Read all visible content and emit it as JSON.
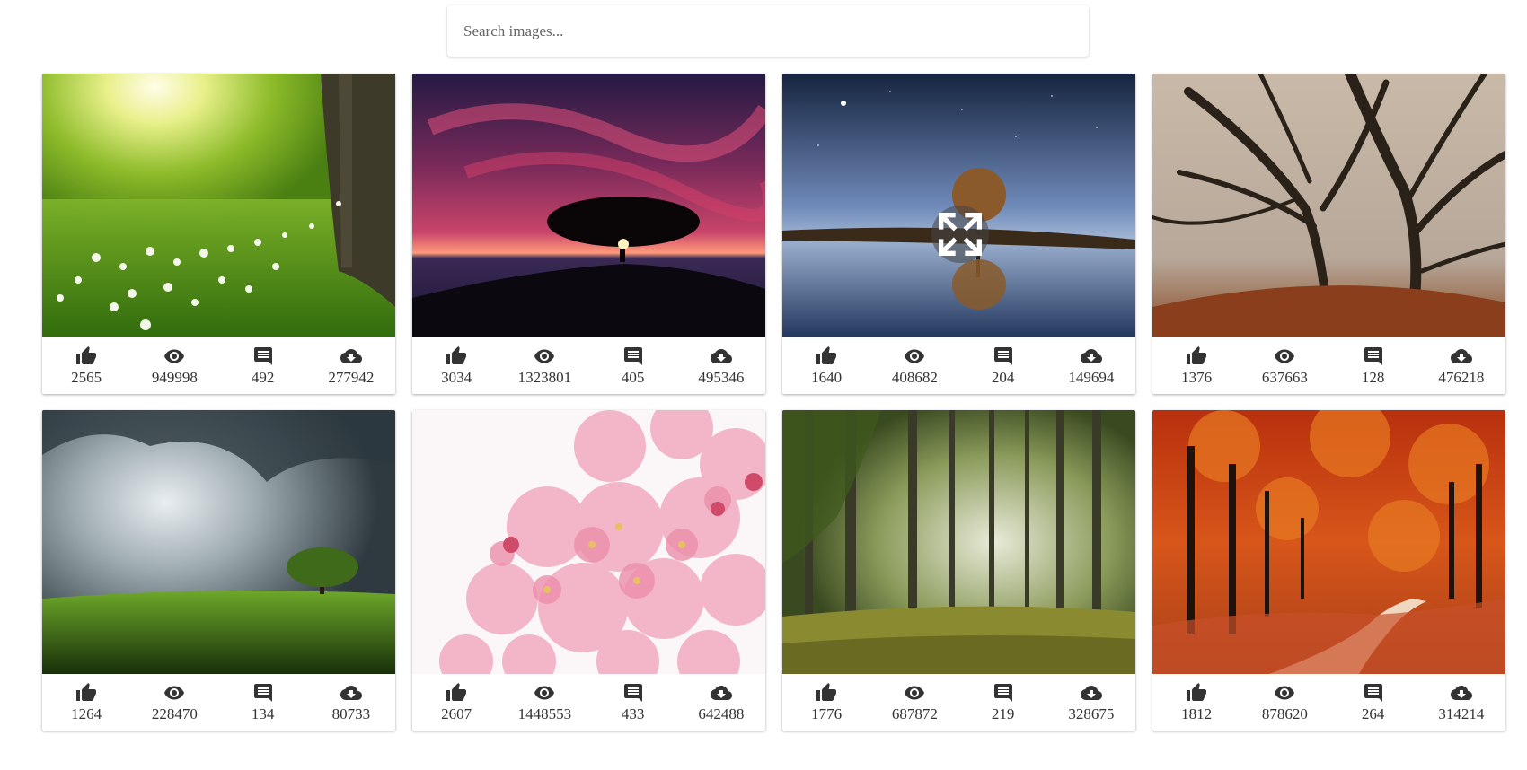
{
  "search": {
    "placeholder": "Search images..."
  },
  "icons": {
    "likes": "thumbs-up-icon",
    "views": "eye-icon",
    "comments": "comment-icon",
    "downloads": "cloud-download-icon",
    "expand": "expand-icon"
  },
  "cards": [
    {
      "likes": "2565",
      "views": "949998",
      "comments": "492",
      "downloads": "277942"
    },
    {
      "likes": "3034",
      "views": "1323801",
      "comments": "405",
      "downloads": "495346"
    },
    {
      "likes": "1640",
      "views": "408682",
      "comments": "204",
      "downloads": "149694"
    },
    {
      "likes": "1376",
      "views": "637663",
      "comments": "128",
      "downloads": "476218"
    },
    {
      "likes": "1264",
      "views": "228470",
      "comments": "134",
      "downloads": "80733"
    },
    {
      "likes": "2607",
      "views": "1448553",
      "comments": "433",
      "downloads": "642488"
    },
    {
      "likes": "1776",
      "views": "687872",
      "comments": "219",
      "downloads": "328675"
    },
    {
      "likes": "1812",
      "views": "878620",
      "comments": "264",
      "downloads": "314214"
    }
  ]
}
